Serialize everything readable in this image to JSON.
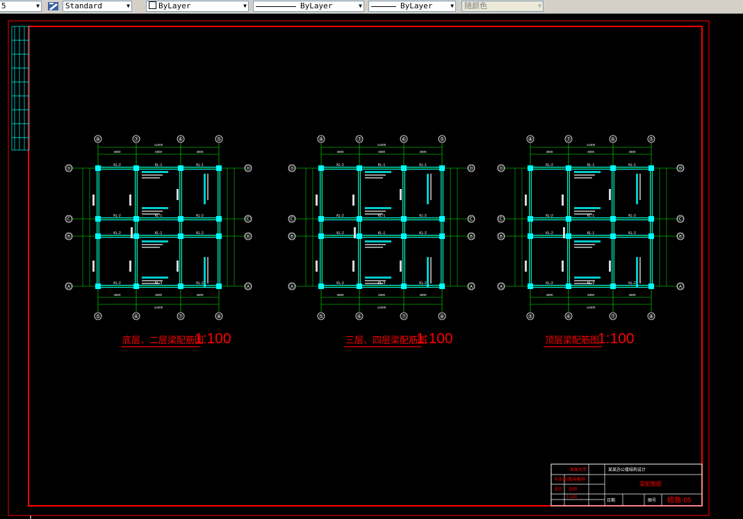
{
  "toolbar": {
    "layer_value": "5",
    "style_label": "Standard",
    "layer_combo": "ByLayer",
    "linetype_combo": "ByLayer",
    "lineweight_combo": "ByLayer",
    "plotstyle_combo": "随颜色"
  },
  "colors": {
    "background": "#000000",
    "border": "#ff0000",
    "grid": "#00ff00",
    "beam": "#00ffff",
    "text": "#ffffff",
    "title": "#ff0000"
  },
  "plans": [
    {
      "title": "底层、二层梁配筋图",
      "scale": "1:100",
      "top_axes": [
        "⑧",
        "⑦",
        "⑥",
        "⑤"
      ],
      "bottom_axes": [
        "⑤",
        "⑥",
        "⑦",
        "⑧"
      ],
      "row_axes": [
        "Ⓓ",
        "Ⓒ",
        "Ⓑ",
        "Ⓐ"
      ],
      "dim_total": "14400",
      "dims": [
        "4800",
        "4800",
        "4800"
      ],
      "beam_labels": [
        "KL-2",
        "KL-1",
        "KL-1",
        "KL-2",
        "KL-2",
        "KL-2",
        "KL-2",
        "KL-2",
        "KL-2",
        "KL-1",
        "KL-1",
        "KL-3"
      ]
    },
    {
      "title": "三层、四层梁配筋图",
      "scale": "1:100",
      "top_axes": [
        "⑧",
        "⑦",
        "⑥",
        "⑤"
      ],
      "bottom_axes": [
        "⑤",
        "⑥",
        "⑦",
        "⑧"
      ],
      "row_axes": [
        "Ⓓ",
        "Ⓒ",
        "Ⓑ",
        "Ⓐ"
      ],
      "dim_total": "14400",
      "dims": [
        "4800",
        "4800",
        "4800"
      ],
      "beam_labels": [
        "KL-2",
        "KL-1",
        "KL-1",
        "KL-2",
        "KL-2",
        "KL-2",
        "KL-2",
        "KL-2",
        "KL-2",
        "KL-1",
        "KL-1",
        "KL-3"
      ]
    },
    {
      "title": "顶层梁配筋图",
      "scale": "1:100",
      "top_axes": [
        "⑧",
        "⑦",
        "⑥",
        "⑤"
      ],
      "bottom_axes": [
        "⑤",
        "⑥",
        "⑦",
        "⑧"
      ],
      "row_axes": [
        "Ⓓ",
        "Ⓒ",
        "Ⓑ",
        "Ⓐ"
      ],
      "dim_total": "14400",
      "dims": [
        "4800",
        "4800",
        "4800"
      ],
      "beam_labels": [
        "KL-2",
        "KL-1",
        "KL-1",
        "KL-2",
        "KL-2",
        "KL-2",
        "KL-2",
        "KL-2",
        "KL-2",
        "KL-1",
        "KL-1",
        "KL-3"
      ]
    }
  ],
  "title_block": {
    "school": "某某大学",
    "project": "某某办公楼结构设计",
    "c1": "毕业设计",
    "c2": "指导教师",
    "c3": "设计",
    "c4": "比例",
    "drawing_name": "梁配筋图",
    "sheet_label": "图号",
    "sheet_no": "结施-05",
    "scale_value": "1:100",
    "date_label": "日期"
  }
}
